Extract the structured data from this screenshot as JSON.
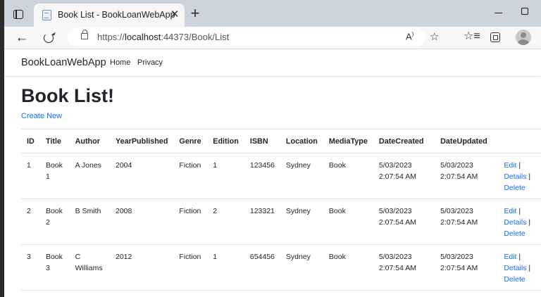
{
  "browser": {
    "tab_title": "Book List - BookLoanWebApp",
    "tab_close": "✕",
    "new_tab": "+",
    "url_scheme": "https://",
    "url_host": "localhost",
    "url_rest": ":44373/Book/List",
    "read_aloud": "A)",
    "add_favorite": "☆",
    "favorites": "☆"
  },
  "navbar": {
    "brand": "BookLoanWebApp",
    "links": [
      "Home",
      "Privacy"
    ]
  },
  "page": {
    "heading": "Book List!",
    "create_new": "Create New"
  },
  "table": {
    "headers": [
      "ID",
      "Title",
      "Author",
      "YearPublished",
      "Genre",
      "Edition",
      "ISBN",
      "Location",
      "MediaType",
      "DateCreated",
      "DateUpdated"
    ],
    "rows": [
      {
        "id": "1",
        "title": "Book 1",
        "author": "A Jones",
        "year": "2004",
        "genre": "Fiction",
        "edition": "1",
        "isbn": "123456",
        "location": "Sydney",
        "media": "Book",
        "created": "5/03/2023 2:07:54 AM",
        "updated": "5/03/2023 2:07:54 AM"
      },
      {
        "id": "2",
        "title": "Book 2",
        "author": "B Smith",
        "year": "2008",
        "genre": "Fiction",
        "edition": "2",
        "isbn": "123321",
        "location": "Sydney",
        "media": "Book",
        "created": "5/03/2023 2:07:54 AM",
        "updated": "5/03/2023 2:07:54 AM"
      },
      {
        "id": "3",
        "title": "Book 3",
        "author": "C Williams",
        "year": "2012",
        "genre": "Fiction",
        "edition": "1",
        "isbn": "654456",
        "location": "Sydney",
        "media": "Book",
        "created": "5/03/2023 2:07:54 AM",
        "updated": "5/03/2023 2:07:54 AM"
      }
    ],
    "actions": {
      "edit": "Edit",
      "details": "Details",
      "delete": "Delete",
      "separator": " |"
    }
  },
  "colors": {
    "link": "#0d6efd",
    "text": "#212529",
    "tabstrip": "#cdd3dc"
  }
}
